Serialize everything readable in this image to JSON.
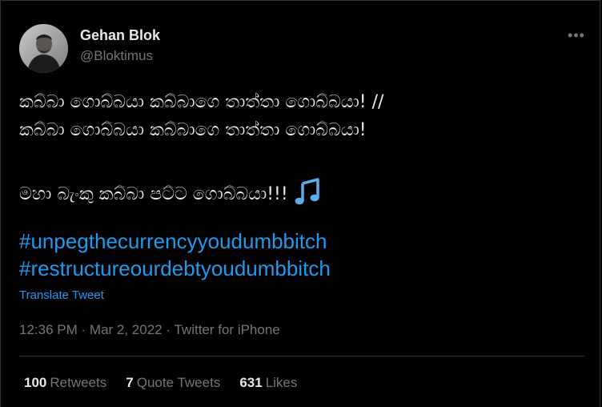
{
  "author": {
    "name": "Gehan Blok",
    "handle": "@Bloktimus"
  },
  "tweet": {
    "lines": [
      "කබ්බා ගොබ්බයා කබ්බාගෙ තාත්තා ගොබ්බයා! //",
      "කබ්බා ගොබ්බයා කබ්බාගෙ තාත්තා ගොබ්බයා!",
      "මහා බැංකු කබ්බා පට්ට ගොබ්බයා!!!"
    ],
    "hashtags": [
      "#unpegthecurrencyyoudumbbitch",
      "#restructureourdebtyoudumbbitch"
    ],
    "translate_label": "Translate Tweet"
  },
  "meta": {
    "time": "12:36 PM",
    "separator": "·",
    "date": "Mar 2, 2022",
    "source": "Twitter for iPhone"
  },
  "stats": {
    "retweets_count": "100",
    "retweets_label": "Retweets",
    "quotes_count": "7",
    "quotes_label": "Quote Tweets",
    "likes_count": "631",
    "likes_label": "Likes"
  },
  "icons": {
    "more": "more-horizontal-icon",
    "music": "music-notes-emoji"
  },
  "colors": {
    "background": "#000000",
    "text": "#e7e9ea",
    "muted": "#71767b",
    "link": "#1d9bf0",
    "divider": "#2f3336"
  }
}
